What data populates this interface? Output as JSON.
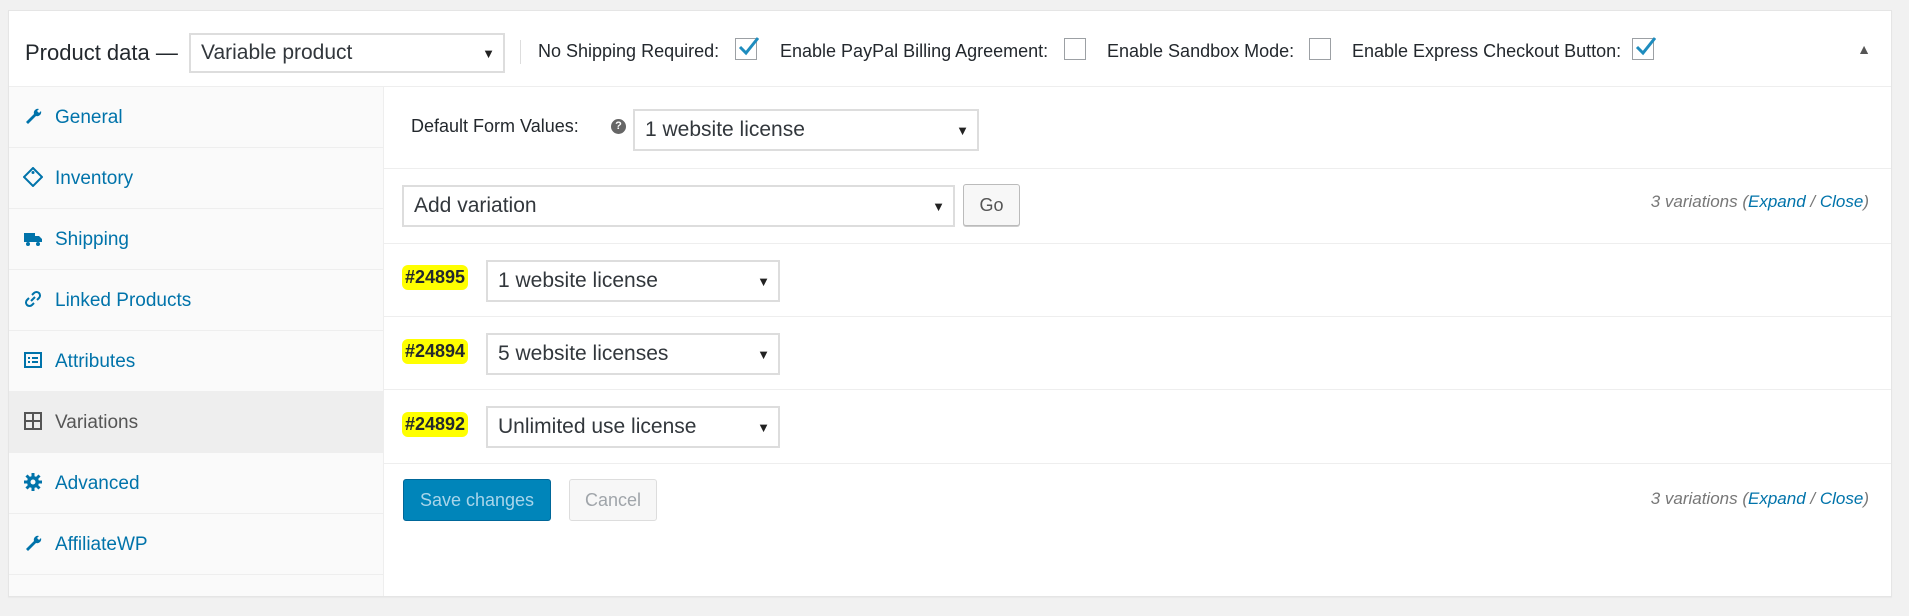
{
  "header": {
    "title": "Product data —",
    "product_type": "Variable product",
    "options": [
      {
        "label": "No Shipping Required:",
        "checked": true
      },
      {
        "label": "Enable PayPal Billing Agreement:",
        "checked": false
      },
      {
        "label": "Enable Sandbox Mode:",
        "checked": false
      },
      {
        "label": "Enable Express Checkout Button:",
        "checked": true
      }
    ]
  },
  "sidebar": {
    "items": [
      {
        "label": "General",
        "icon": "wrench-icon"
      },
      {
        "label": "Inventory",
        "icon": "tag-icon"
      },
      {
        "label": "Shipping",
        "icon": "truck-icon"
      },
      {
        "label": "Linked Products",
        "icon": "link-icon"
      },
      {
        "label": "Attributes",
        "icon": "list-icon"
      },
      {
        "label": "Variations",
        "icon": "grid-icon",
        "active": true
      },
      {
        "label": "Advanced",
        "icon": "gear-icon"
      },
      {
        "label": "AffiliateWP",
        "icon": "wrench-icon"
      }
    ]
  },
  "main": {
    "default_form_values": {
      "label": "Default Form Values:",
      "value": "1 website license"
    },
    "add_variation": {
      "value": "Add variation",
      "go_label": "Go"
    },
    "variations_count": {
      "text": "3 variations (",
      "expand": "Expand",
      "sep": " / ",
      "close": "Close",
      "end": ")"
    },
    "variations": [
      {
        "id": "#24895",
        "value": "1 website license"
      },
      {
        "id": "#24894",
        "value": "5 website licenses"
      },
      {
        "id": "#24892",
        "value": "Unlimited use license"
      }
    ],
    "save_label": "Save changes",
    "cancel_label": "Cancel"
  },
  "colors": {
    "accent": "#0073aa",
    "primary_button": "#0085ba",
    "highlight": "#ffff00"
  }
}
